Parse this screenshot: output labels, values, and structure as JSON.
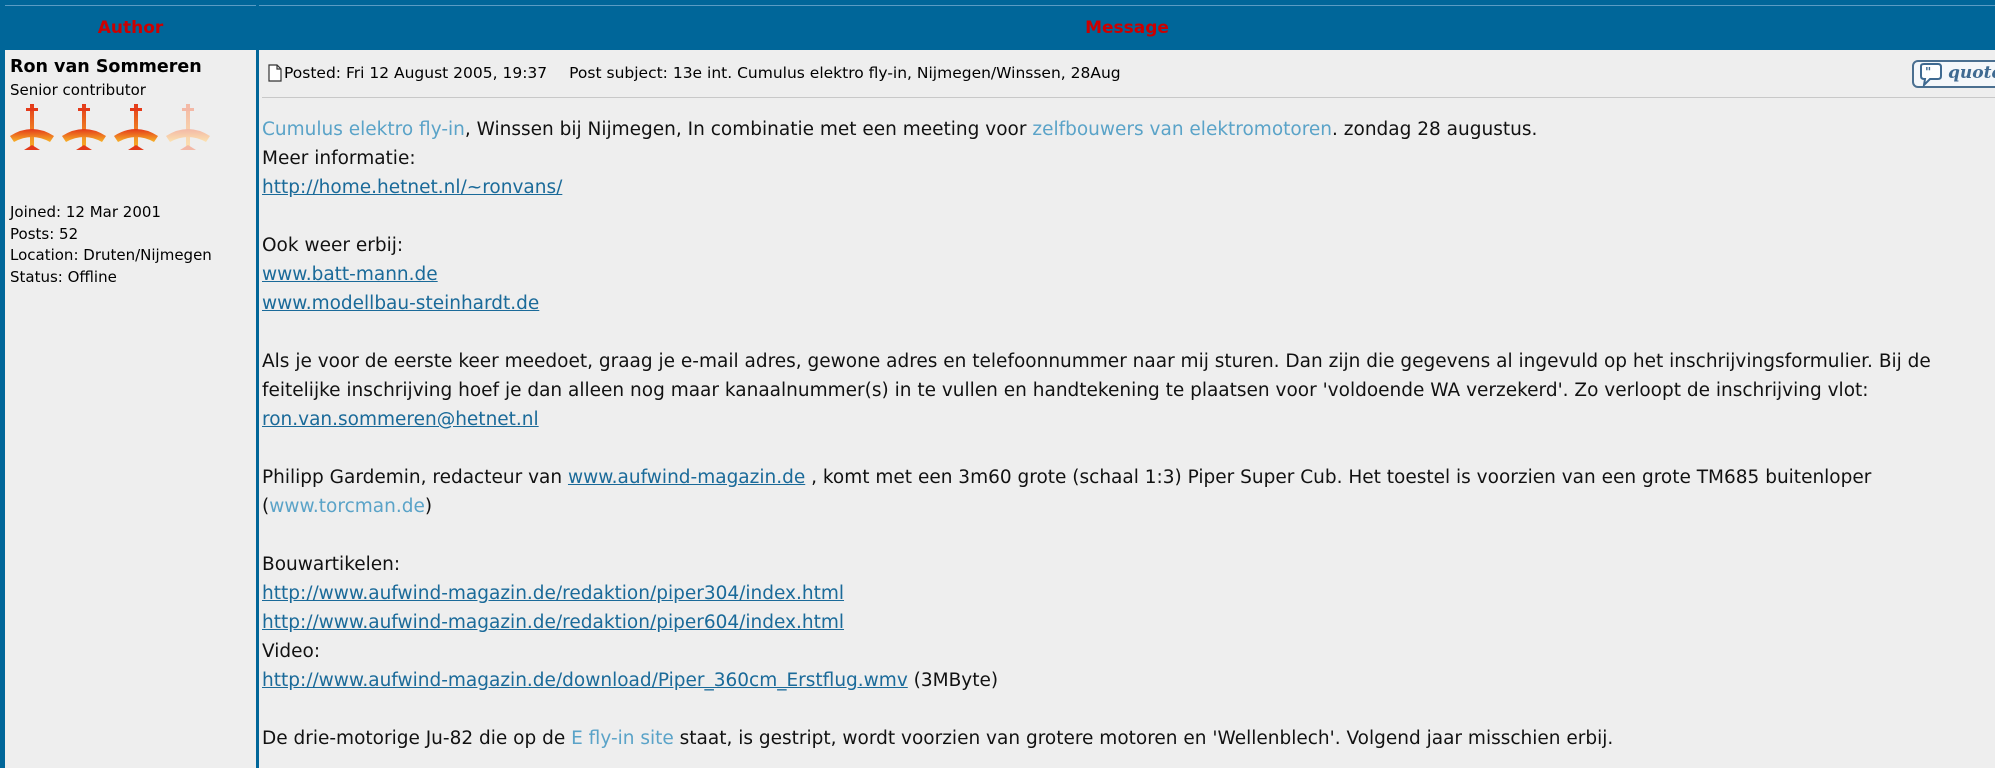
{
  "table": {
    "author_header": "Author",
    "message_header": "Message"
  },
  "profile": {
    "username": "Ron van Sommeren",
    "rank": "Senior contributor",
    "joined": "Joined: 12 Mar 2001",
    "posts": "Posts: 52",
    "location": "Location: Druten/Nijmegen",
    "status": "Status: Offline",
    "rank_icon": "airplane-rank-icons"
  },
  "post": {
    "posted": "Posted: Fri 12 August 2005, 19:37",
    "subject": "Post subject: 13e int. Cumulus elektro fly-in, Nijmegen/Winssen, 28Aug",
    "quote_label": "quote"
  },
  "body": {
    "p1": {
      "link1": "Cumulus elektro fly-in",
      "t1": ", Winssen bij Nijmegen, In combinatie met een meeting voor ",
      "link2": "zelfbouwers van elektromotoren",
      "t2": ". zondag 28 augustus.",
      "t3": "Meer informatie:",
      "url": "http://home.hetnet.nl/~ronvans/"
    },
    "p2": {
      "t1": "Ook weer erbij:",
      "url1": "www.batt-mann.de",
      "url2": "www.modellbau-steinhardt.de"
    },
    "p3": {
      "t1": "Als je voor de eerste keer meedoet, graag je e-mail adres, gewone adres en telefoonnummer naar mij sturen. Dan zijn die gegevens al ingevuld op het inschrijvingsformulier. Bij de feitelijke inschrijving hoef je dan alleen nog maar kanaalnummer(s) in te vullen en handtekening te plaatsen voor 'voldoende WA verzekerd'. Zo verloopt de inschrijving vlot:",
      "email": "ron.van.sommeren@hetnet.nl"
    },
    "p4": {
      "t1": "Philipp Gardemin, redacteur van ",
      "url": "www.aufwind-magazin.de",
      "t2": " , komt met een 3m60 grote (schaal 1:3) Piper Super Cub. Het toestel is voorzien van een grote TM685 buitenloper (",
      "link": "www.torcman.de",
      "t3": ")"
    },
    "p5": {
      "t1": "Bouwartikelen:",
      "url1": "http://www.aufwind-magazin.de/redaktion/piper304/index.html",
      "url2": "http://www.aufwind-magazin.de/redaktion/piper604/index.html",
      "t2": "Video:",
      "url3": "http://www.aufwind-magazin.de/download/Piper_360cm_Erstflug.wmv",
      "t3": " (3MByte)"
    },
    "p6": {
      "t1": "De drie-motorige Ju-82 die op de ",
      "link": "E fly-in site",
      "t2": " staat, is gestript, wordt voorzien van grotere motoren en 'Wellenblech'. Volgend jaar misschien erbij."
    }
  },
  "colors": {
    "frame_blue": "#006699",
    "header_text_red": "#cc0000",
    "cell_bg": "#eeeeee",
    "link": "#1a6a99",
    "highlight_link": "#5aa3c8"
  }
}
